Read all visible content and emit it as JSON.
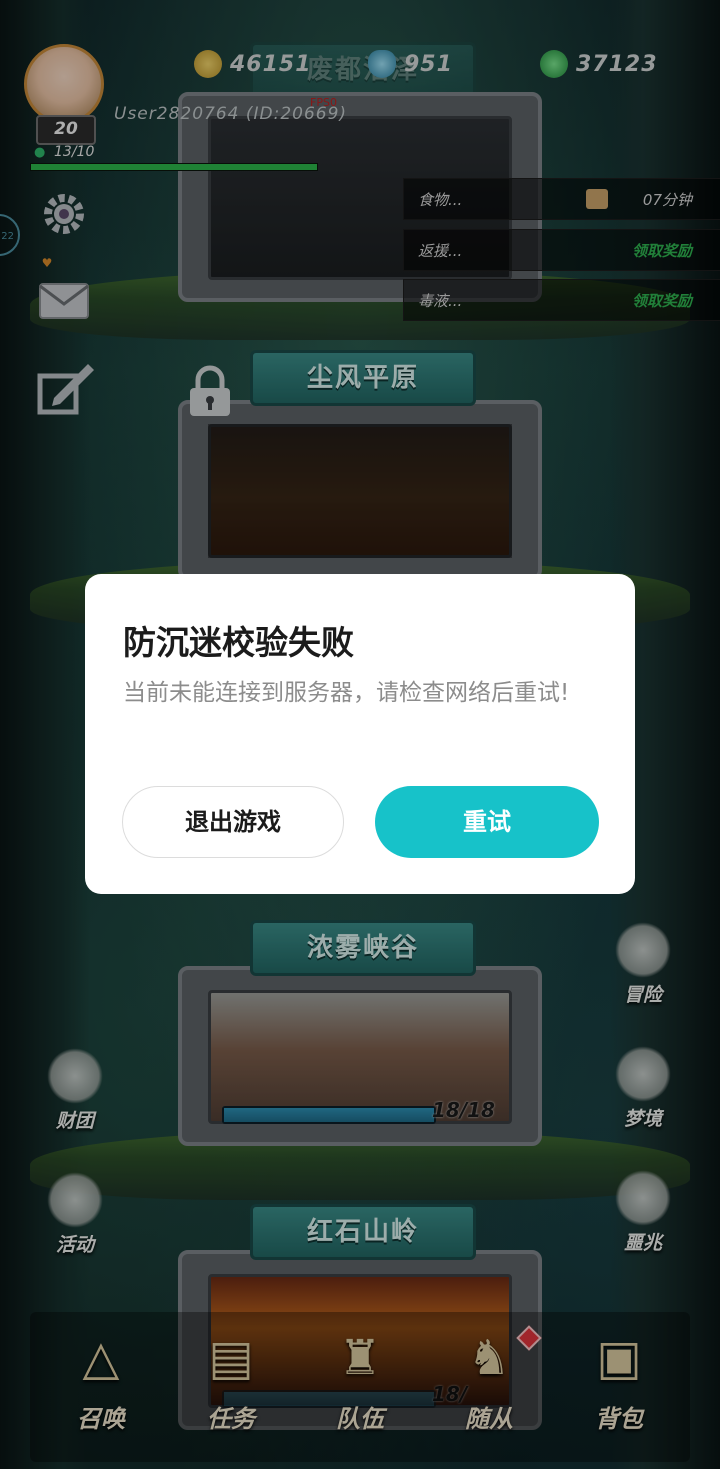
{
  "hud": {
    "user": "User2820764 (ID:20669)",
    "fps_label": "FPS0",
    "level": "20",
    "energy": "13/10",
    "energy_fraction": 1.0
  },
  "currencies": [
    {
      "icon": "gold-coin-icon",
      "value": "46151",
      "color": "#c9a83a"
    },
    {
      "icon": "blue-gem-icon",
      "value": "951",
      "color": "#3aa6c9"
    },
    {
      "icon": "green-orb-icon",
      "value": "37123",
      "color": "#2fb24f"
    }
  ],
  "tasks": [
    {
      "name": "食物...",
      "right": "07分钟",
      "right_type": "timer"
    },
    {
      "name": "返援...",
      "right": "领取奖励",
      "right_type": "claim"
    },
    {
      "name": "毒液...",
      "right": "领取奖励",
      "right_type": "claim"
    }
  ],
  "levels": {
    "top_title": "废都沼泽",
    "dust": "尘风平原",
    "fog": "浓雾峡谷",
    "fog_progress": "18/18",
    "fog_progress_fraction": 1.0,
    "red": "红石山岭",
    "red_progress": "18/"
  },
  "left_menu": {
    "caituan": "财团",
    "huodong": "活动"
  },
  "right_menu": {
    "maoxian": "冒险",
    "mengjing": "梦境",
    "eZhao": "噩兆"
  },
  "bottom_nav": {
    "summon": "召唤",
    "task": "任务",
    "team": "队伍",
    "follower": "随从",
    "bag": "背包"
  },
  "dialog": {
    "title": "防沉迷校验失败",
    "message": "当前未能连接到服务器，请检查网络后重试!",
    "exit_label": "退出游戏",
    "retry_label": "重试",
    "retry_color": "#17c2c9"
  },
  "left_edge_label": "22"
}
